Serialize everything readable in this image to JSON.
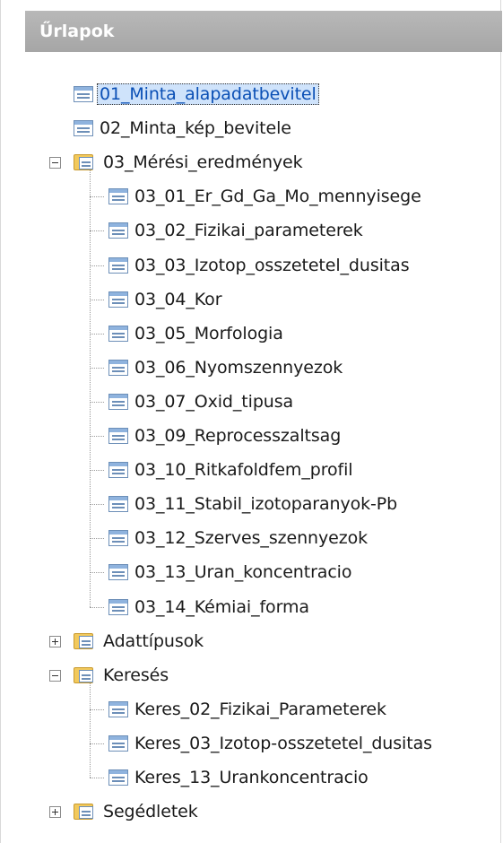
{
  "header": {
    "title": "Űrlapok"
  },
  "tree": {
    "items": [
      {
        "label": "01_Minta_alapadatbevitel",
        "level": 0,
        "kind": "form",
        "selected": true
      },
      {
        "label": "02_Minta_kép_bevitele",
        "level": 0,
        "kind": "form"
      },
      {
        "label": "03_Mérési_eredmények",
        "level": 0,
        "kind": "folder",
        "expanded": true
      },
      {
        "label": "03_01_Er_Gd_Ga_Mo_mennyisege",
        "level": 1,
        "kind": "form"
      },
      {
        "label": "03_02_Fizikai_parameterek",
        "level": 1,
        "kind": "form"
      },
      {
        "label": "03_03_Izotop_osszetetel_dusitas",
        "level": 1,
        "kind": "form"
      },
      {
        "label": "03_04_Kor",
        "level": 1,
        "kind": "form"
      },
      {
        "label": "03_05_Morfologia",
        "level": 1,
        "kind": "form"
      },
      {
        "label": "03_06_Nyomszennyezok",
        "level": 1,
        "kind": "form"
      },
      {
        "label": "03_07_Oxid_tipusa",
        "level": 1,
        "kind": "form"
      },
      {
        "label": "03_09_Reprocesszaltsag",
        "level": 1,
        "kind": "form"
      },
      {
        "label": "03_10_Ritkafoldfem_profil",
        "level": 1,
        "kind": "form"
      },
      {
        "label": "03_11_Stabil_izotoparanyok-Pb",
        "level": 1,
        "kind": "form"
      },
      {
        "label": "03_12_Szerves_szennyezok",
        "level": 1,
        "kind": "form"
      },
      {
        "label": "03_13_Uran_koncentracio",
        "level": 1,
        "kind": "form"
      },
      {
        "label": "03_14_Kémiai_forma",
        "level": 1,
        "kind": "form"
      },
      {
        "label": "Adattípusok",
        "level": 0,
        "kind": "folder",
        "expanded": false
      },
      {
        "label": "Keresés",
        "level": 0,
        "kind": "folder",
        "expanded": true
      },
      {
        "label": "Keres_02_Fizikai_Parameterek",
        "level": 1,
        "kind": "form"
      },
      {
        "label": "Keres_03_Izotop-osszetetel_dusitas",
        "level": 1,
        "kind": "form"
      },
      {
        "label": "Keres_13_Urankoncentracio",
        "level": 1,
        "kind": "form"
      },
      {
        "label": "Segédletek",
        "level": 0,
        "kind": "folder",
        "expanded": false
      }
    ]
  }
}
